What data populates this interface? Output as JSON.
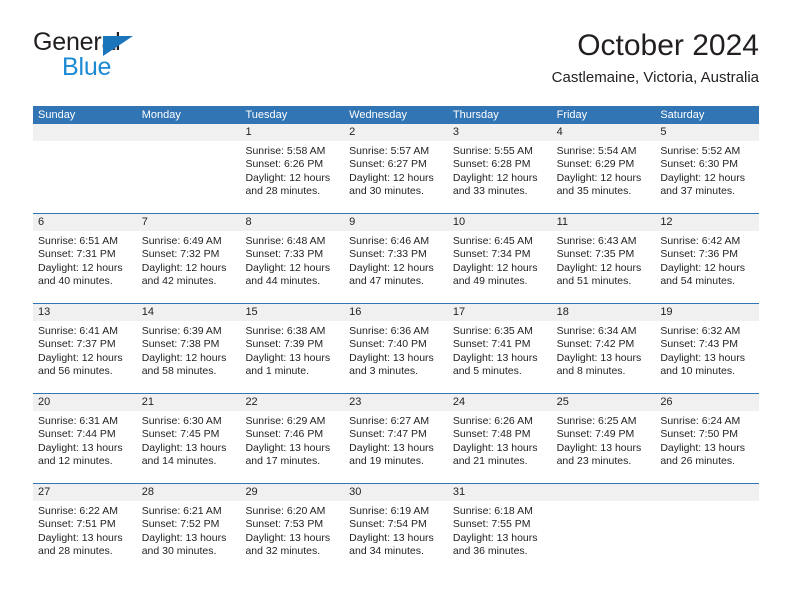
{
  "brand": {
    "name_top": "General",
    "name_bottom": "Blue",
    "accent_color": "#1b89d4",
    "triangle_color": "#1b75bb"
  },
  "header": {
    "title": "October 2024",
    "subtitle": "Castlemaine, Victoria, Australia"
  },
  "theme": {
    "header_blue": "#3275b4",
    "date_band": "#f0f0f0",
    "text": "#231f20"
  },
  "weekdays": [
    "Sunday",
    "Monday",
    "Tuesday",
    "Wednesday",
    "Thursday",
    "Friday",
    "Saturday"
  ],
  "weeks": [
    [
      {
        "date": "",
        "lines": []
      },
      {
        "date": "",
        "lines": []
      },
      {
        "date": "1",
        "lines": [
          "Sunrise: 5:58 AM",
          "Sunset: 6:26 PM",
          "Daylight: 12 hours",
          "and 28 minutes."
        ]
      },
      {
        "date": "2",
        "lines": [
          "Sunrise: 5:57 AM",
          "Sunset: 6:27 PM",
          "Daylight: 12 hours",
          "and 30 minutes."
        ]
      },
      {
        "date": "3",
        "lines": [
          "Sunrise: 5:55 AM",
          "Sunset: 6:28 PM",
          "Daylight: 12 hours",
          "and 33 minutes."
        ]
      },
      {
        "date": "4",
        "lines": [
          "Sunrise: 5:54 AM",
          "Sunset: 6:29 PM",
          "Daylight: 12 hours",
          "and 35 minutes."
        ]
      },
      {
        "date": "5",
        "lines": [
          "Sunrise: 5:52 AM",
          "Sunset: 6:30 PM",
          "Daylight: 12 hours",
          "and 37 minutes."
        ]
      }
    ],
    [
      {
        "date": "6",
        "lines": [
          "Sunrise: 6:51 AM",
          "Sunset: 7:31 PM",
          "Daylight: 12 hours",
          "and 40 minutes."
        ]
      },
      {
        "date": "7",
        "lines": [
          "Sunrise: 6:49 AM",
          "Sunset: 7:32 PM",
          "Daylight: 12 hours",
          "and 42 minutes."
        ]
      },
      {
        "date": "8",
        "lines": [
          "Sunrise: 6:48 AM",
          "Sunset: 7:33 PM",
          "Daylight: 12 hours",
          "and 44 minutes."
        ]
      },
      {
        "date": "9",
        "lines": [
          "Sunrise: 6:46 AM",
          "Sunset: 7:33 PM",
          "Daylight: 12 hours",
          "and 47 minutes."
        ]
      },
      {
        "date": "10",
        "lines": [
          "Sunrise: 6:45 AM",
          "Sunset: 7:34 PM",
          "Daylight: 12 hours",
          "and 49 minutes."
        ]
      },
      {
        "date": "11",
        "lines": [
          "Sunrise: 6:43 AM",
          "Sunset: 7:35 PM",
          "Daylight: 12 hours",
          "and 51 minutes."
        ]
      },
      {
        "date": "12",
        "lines": [
          "Sunrise: 6:42 AM",
          "Sunset: 7:36 PM",
          "Daylight: 12 hours",
          "and 54 minutes."
        ]
      }
    ],
    [
      {
        "date": "13",
        "lines": [
          "Sunrise: 6:41 AM",
          "Sunset: 7:37 PM",
          "Daylight: 12 hours",
          "and 56 minutes."
        ]
      },
      {
        "date": "14",
        "lines": [
          "Sunrise: 6:39 AM",
          "Sunset: 7:38 PM",
          "Daylight: 12 hours",
          "and 58 minutes."
        ]
      },
      {
        "date": "15",
        "lines": [
          "Sunrise: 6:38 AM",
          "Sunset: 7:39 PM",
          "Daylight: 13 hours",
          "and 1 minute."
        ]
      },
      {
        "date": "16",
        "lines": [
          "Sunrise: 6:36 AM",
          "Sunset: 7:40 PM",
          "Daylight: 13 hours",
          "and 3 minutes."
        ]
      },
      {
        "date": "17",
        "lines": [
          "Sunrise: 6:35 AM",
          "Sunset: 7:41 PM",
          "Daylight: 13 hours",
          "and 5 minutes."
        ]
      },
      {
        "date": "18",
        "lines": [
          "Sunrise: 6:34 AM",
          "Sunset: 7:42 PM",
          "Daylight: 13 hours",
          "and 8 minutes."
        ]
      },
      {
        "date": "19",
        "lines": [
          "Sunrise: 6:32 AM",
          "Sunset: 7:43 PM",
          "Daylight: 13 hours",
          "and 10 minutes."
        ]
      }
    ],
    [
      {
        "date": "20",
        "lines": [
          "Sunrise: 6:31 AM",
          "Sunset: 7:44 PM",
          "Daylight: 13 hours",
          "and 12 minutes."
        ]
      },
      {
        "date": "21",
        "lines": [
          "Sunrise: 6:30 AM",
          "Sunset: 7:45 PM",
          "Daylight: 13 hours",
          "and 14 minutes."
        ]
      },
      {
        "date": "22",
        "lines": [
          "Sunrise: 6:29 AM",
          "Sunset: 7:46 PM",
          "Daylight: 13 hours",
          "and 17 minutes."
        ]
      },
      {
        "date": "23",
        "lines": [
          "Sunrise: 6:27 AM",
          "Sunset: 7:47 PM",
          "Daylight: 13 hours",
          "and 19 minutes."
        ]
      },
      {
        "date": "24",
        "lines": [
          "Sunrise: 6:26 AM",
          "Sunset: 7:48 PM",
          "Daylight: 13 hours",
          "and 21 minutes."
        ]
      },
      {
        "date": "25",
        "lines": [
          "Sunrise: 6:25 AM",
          "Sunset: 7:49 PM",
          "Daylight: 13 hours",
          "and 23 minutes."
        ]
      },
      {
        "date": "26",
        "lines": [
          "Sunrise: 6:24 AM",
          "Sunset: 7:50 PM",
          "Daylight: 13 hours",
          "and 26 minutes."
        ]
      }
    ],
    [
      {
        "date": "27",
        "lines": [
          "Sunrise: 6:22 AM",
          "Sunset: 7:51 PM",
          "Daylight: 13 hours",
          "and 28 minutes."
        ]
      },
      {
        "date": "28",
        "lines": [
          "Sunrise: 6:21 AM",
          "Sunset: 7:52 PM",
          "Daylight: 13 hours",
          "and 30 minutes."
        ]
      },
      {
        "date": "29",
        "lines": [
          "Sunrise: 6:20 AM",
          "Sunset: 7:53 PM",
          "Daylight: 13 hours",
          "and 32 minutes."
        ]
      },
      {
        "date": "30",
        "lines": [
          "Sunrise: 6:19 AM",
          "Sunset: 7:54 PM",
          "Daylight: 13 hours",
          "and 34 minutes."
        ]
      },
      {
        "date": "31",
        "lines": [
          "Sunrise: 6:18 AM",
          "Sunset: 7:55 PM",
          "Daylight: 13 hours",
          "and 36 minutes."
        ]
      },
      {
        "date": "",
        "lines": []
      },
      {
        "date": "",
        "lines": []
      }
    ]
  ]
}
